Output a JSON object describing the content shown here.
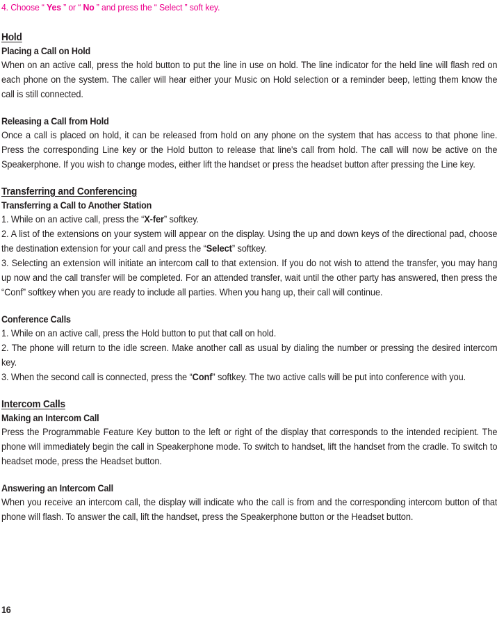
{
  "document": {
    "page_number": "16",
    "accent_color": "#ec008c",
    "text_color": "#231f20"
  },
  "step_line": {
    "prefix": "4. Choose “ ",
    "bold1": "Yes",
    "mid1": " ” or “ ",
    "bold2": "No",
    "mid2": " ” and press the “ Select ” soft key."
  },
  "sections": [
    {
      "heading": "Hold",
      "subsections": [
        {
          "subheading": "Placing a Call on Hold",
          "paragraphs": [
            "When on an active call, press the hold button to put the line in use on hold.  The line indicator for the held line will flash red on each phone on the system.  The caller will hear either your Music on Hold selection or a reminder beep, letting them know the call is still connected."
          ]
        },
        {
          "subheading": "Releasing a Call from Hold",
          "paragraphs": [
            "Once a call is placed on hold, it can be released from hold on any phone on the system that has access to that phone line.  Press the corresponding Line key or the Hold button to release that line's call from hold.  The call will now be active on the Speakerphone.  If you wish to change modes, either lift the handset or press the headset button after pressing the Line key."
          ]
        }
      ]
    },
    {
      "heading": "Transferring and Conferencing",
      "subsections": [
        {
          "subheading": "Transferring a Call to Another Station",
          "steps": [
            {
              "pre": "1. While on an active call, press the “",
              "bold": "X-fer",
              "post": "” softkey."
            },
            {
              "pre": "2. A list of the extensions on your system will appear on the display.  Using the up and down keys of the directional pad, choose the destination extension for your call and press the “",
              "bold": "Select",
              "post": "” softkey."
            },
            {
              "pre": "3. Selecting an extension will initiate an intercom call to that extension.  If you do not wish to attend the transfer, you may hang up now and the call transfer will be completed.  For an attended transfer, wait until the other party has answered, then press the “Conf” softkey when you are ready to include all parties.  When you hang up, their call will continue.",
              "bold": "",
              "post": ""
            }
          ]
        },
        {
          "subheading": "Conference Calls",
          "steps": [
            {
              "pre": "1. While on an active call, press the Hold button to put that call on hold.",
              "bold": "",
              "post": ""
            },
            {
              "pre": "2. The phone will return to the idle screen.  Make another call as usual by dialing the number or pressing the desired intercom key.",
              "bold": "",
              "post": ""
            },
            {
              "pre": "3. When the second call is connected, press the “",
              "bold": "Conf",
              "post": "” softkey.  The two active calls will be put into conference with you."
            }
          ]
        }
      ]
    },
    {
      "heading": "Intercom Calls",
      "subsections": [
        {
          "subheading": "Making an Intercom Call",
          "paragraphs": [
            "Press the Programmable Feature Key button to the left or right of the display that corresponds to the intended recipient.  The phone will immediately begin the call in Speakerphone mode.  To switch to handset, lift the handset from the cradle.  To switch to headset mode, press the Headset button."
          ]
        },
        {
          "subheading": "Answering an Intercom Call",
          "paragraphs": [
            "When you receive an intercom call, the display will indicate who the call is from and the corresponding intercom button of that phone will flash.  To answer the call, lift the handset, press the Speakerphone button or the Headset button."
          ]
        }
      ]
    }
  ]
}
